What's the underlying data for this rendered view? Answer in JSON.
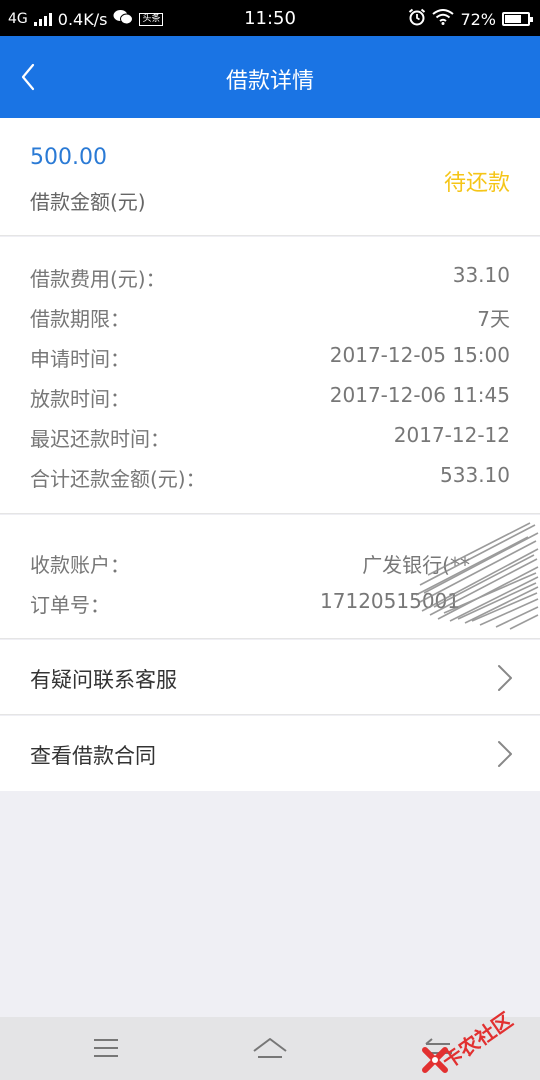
{
  "status_bar": {
    "network": "4G",
    "speed": "0.4K/s",
    "app_badge": "头条",
    "time": "11:50",
    "battery": "72%",
    "battery_level": 0.72
  },
  "nav": {
    "title": "借款详情"
  },
  "summary": {
    "amount": "500.00",
    "amount_label": "借款金额(元)",
    "status": "待还款"
  },
  "details": [
    {
      "label": "借款费用(元)：",
      "value": "33.10"
    },
    {
      "label": "借款期限：",
      "value": "7天"
    },
    {
      "label": "申请时间：",
      "value": "2017-12-05 15:00"
    },
    {
      "label": "放款时间：",
      "value": "2017-12-06 11:45"
    },
    {
      "label": "最迟还款时间：",
      "value": "2017-12-12"
    },
    {
      "label": "合计还款金额(元)：",
      "value": "533.10"
    }
  ],
  "account": [
    {
      "label": "收款账户：",
      "value": "广发银行(**"
    },
    {
      "label": "订单号：",
      "value": "17120515001"
    }
  ],
  "links": {
    "contact": "有疑问联系客服",
    "contract": "查看借款合同"
  },
  "watermark": "卡农社区",
  "colors": {
    "nav": "#1a74e4",
    "amount": "#2a7ad5",
    "status": "#f5c518",
    "watermark": "#e23030"
  }
}
